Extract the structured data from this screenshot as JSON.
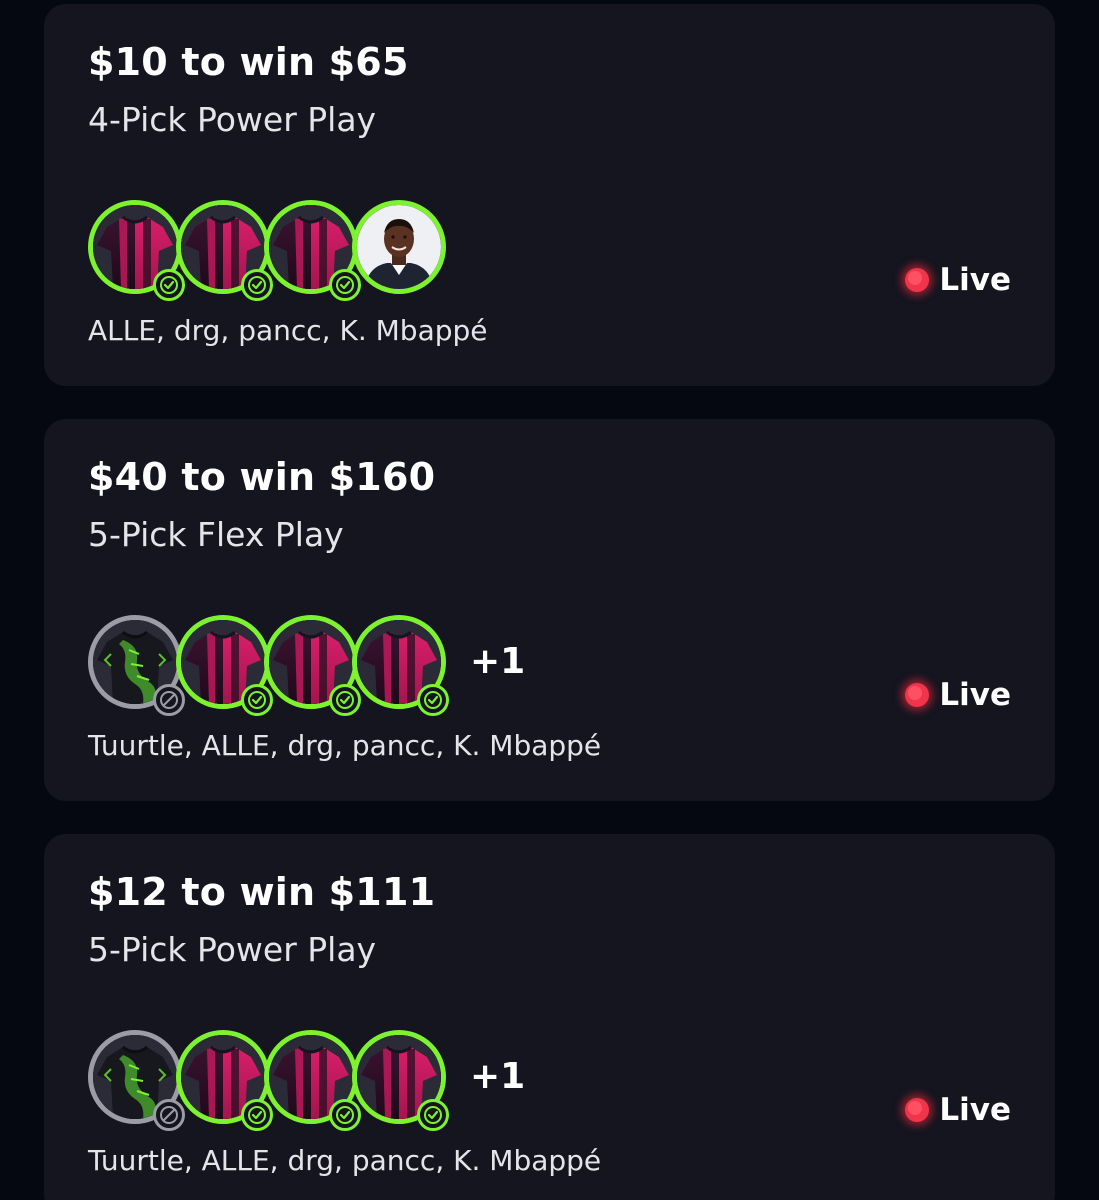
{
  "status_color": "#7df22f",
  "live_color": "#f0354a",
  "entries": [
    {
      "title": "$10 to win $65",
      "subtitle": "4-Pick Power Play",
      "status": "Live",
      "players": "ALLE, drg, pancc, K. Mbappé",
      "more": "",
      "avatars": [
        {
          "kind": "jersey-icon",
          "result": "win"
        },
        {
          "kind": "jersey-icon",
          "result": "win"
        },
        {
          "kind": "jersey-icon",
          "result": "win"
        },
        {
          "kind": "player-photo-icon",
          "result": "pending"
        }
      ]
    },
    {
      "title": "$40 to win $160",
      "subtitle": "5-Pick Flex Play",
      "status": "Live",
      "players": "Tuurtle, ALLE, drg, pancc, K. Mbappé",
      "more": "+1",
      "avatars": [
        {
          "kind": "turtle-jersey-icon",
          "result": "void"
        },
        {
          "kind": "jersey-icon",
          "result": "win"
        },
        {
          "kind": "jersey-icon",
          "result": "win"
        },
        {
          "kind": "jersey-icon",
          "result": "win"
        }
      ]
    },
    {
      "title": "$12 to win $111",
      "subtitle": "5-Pick Power Play",
      "status": "Live",
      "players": "Tuurtle, ALLE, drg, pancc, K. Mbappé",
      "more": "+1",
      "avatars": [
        {
          "kind": "turtle-jersey-icon",
          "result": "void"
        },
        {
          "kind": "jersey-icon",
          "result": "win"
        },
        {
          "kind": "jersey-icon",
          "result": "win"
        },
        {
          "kind": "jersey-icon",
          "result": "win"
        }
      ]
    }
  ]
}
